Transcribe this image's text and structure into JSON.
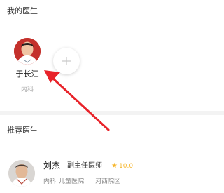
{
  "my_doctors": {
    "title": "我的医生",
    "doctor": {
      "name": "于长江",
      "department": "内科"
    },
    "add_icon": "plus-icon"
  },
  "recommended": {
    "title": "推荐医生",
    "doctor": {
      "name": "刘杰",
      "title": "副主任医师",
      "rating_icon": "star-icon",
      "rating": "10.0",
      "department": "内科",
      "hospital": "儿童医院",
      "district": "河西院区"
    }
  },
  "colors": {
    "accent_red": "#e8232a",
    "rating_gold": "#f6b72f"
  }
}
